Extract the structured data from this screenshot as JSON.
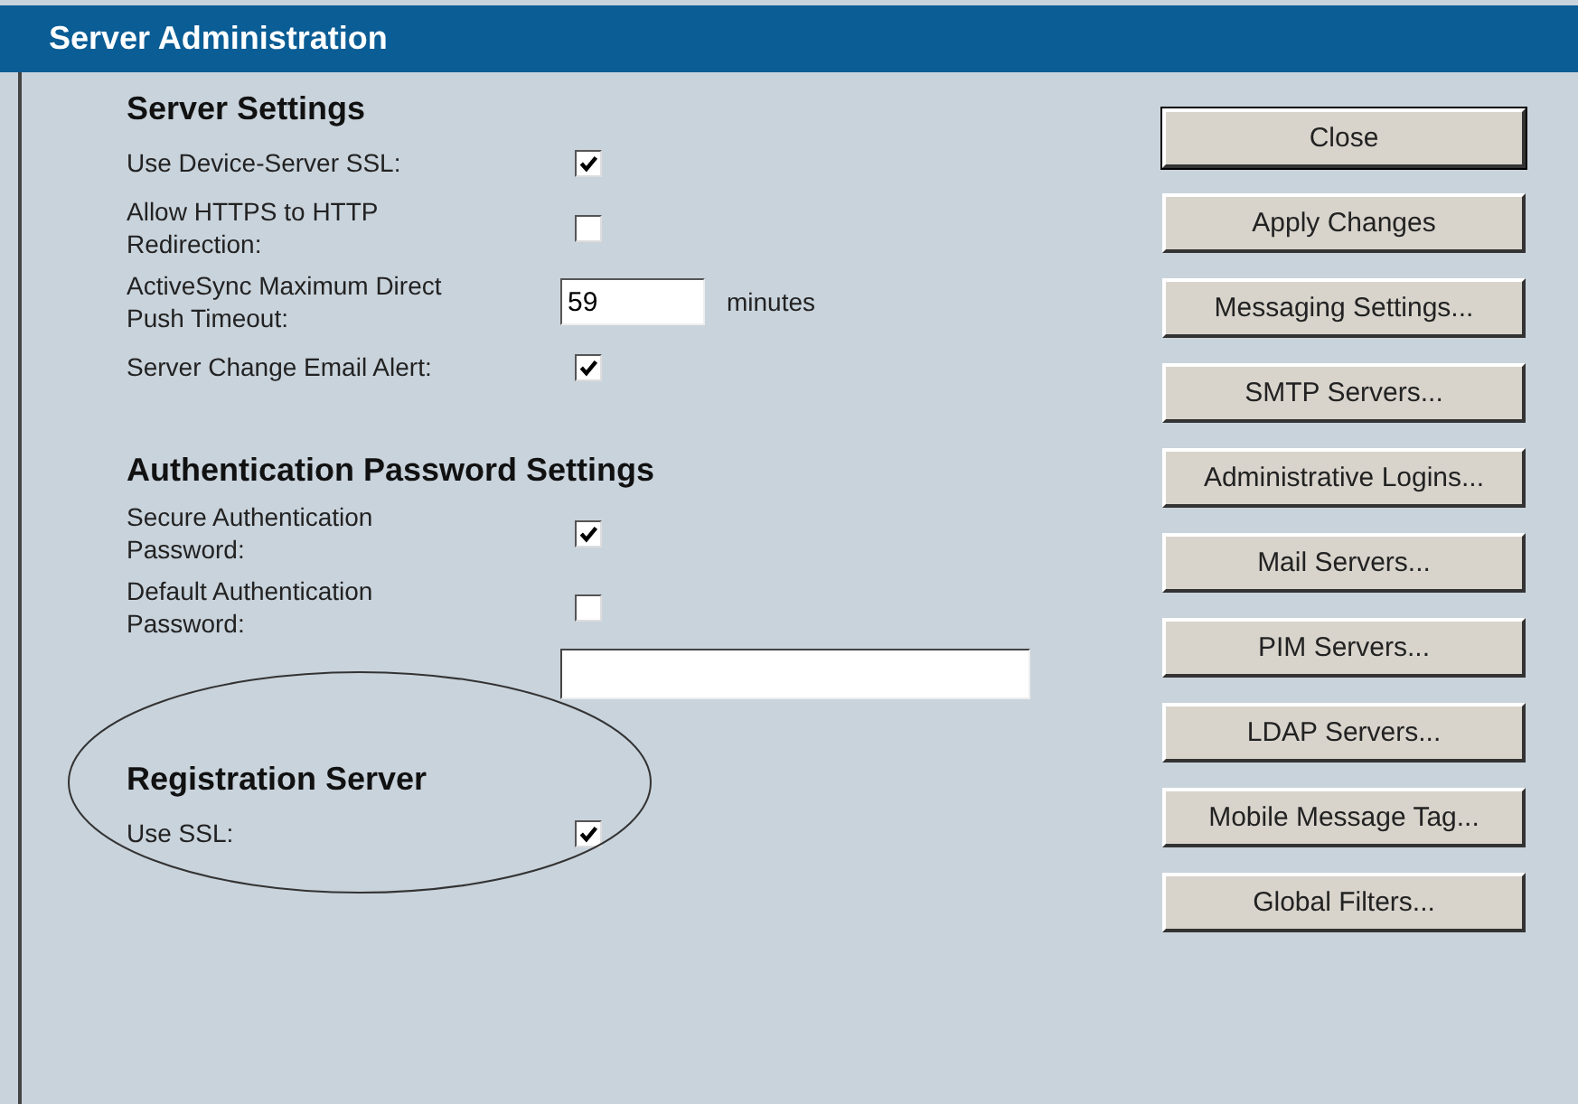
{
  "window": {
    "title": "Server Administration"
  },
  "sections": [
    {
      "heading": "Server Settings",
      "rows": [
        {
          "kind": "checkbox",
          "label": "Use Device-Server SSL:",
          "checked": true
        },
        {
          "kind": "checkbox",
          "label": "Allow HTTPS to HTTP Redirection:",
          "checked": false
        },
        {
          "kind": "number",
          "label": "ActiveSync Maximum Direct Push Timeout:",
          "value": "59",
          "unit": "minutes"
        },
        {
          "kind": "checkbox",
          "label": "Server Change Email Alert:",
          "checked": true
        }
      ]
    },
    {
      "heading": "Authentication Password Settings",
      "rows": [
        {
          "kind": "checkbox",
          "label": "Secure Authentication Password:",
          "checked": true
        },
        {
          "kind": "checkbox",
          "label": "Default Authentication Password:",
          "checked": false
        },
        {
          "kind": "text"
        }
      ]
    },
    {
      "heading": "Registration Server",
      "circled": true,
      "rows": [
        {
          "kind": "checkbox",
          "label": "Use SSL:",
          "checked": true
        }
      ]
    }
  ],
  "buttons": [
    {
      "label": "Close",
      "default": true
    },
    {
      "label": "Apply Changes",
      "default": false
    },
    {
      "label": "Messaging Settings...",
      "default": false
    },
    {
      "label": "SMTP Servers...",
      "default": false
    },
    {
      "label": "Administrative Logins...",
      "default": false
    },
    {
      "label": "Mail Servers...",
      "default": false
    },
    {
      "label": "PIM Servers...",
      "default": false
    },
    {
      "label": "LDAP Servers...",
      "default": false
    },
    {
      "label": "Mobile Message Tag...",
      "default": false
    },
    {
      "label": "Global Filters...",
      "default": false
    }
  ]
}
